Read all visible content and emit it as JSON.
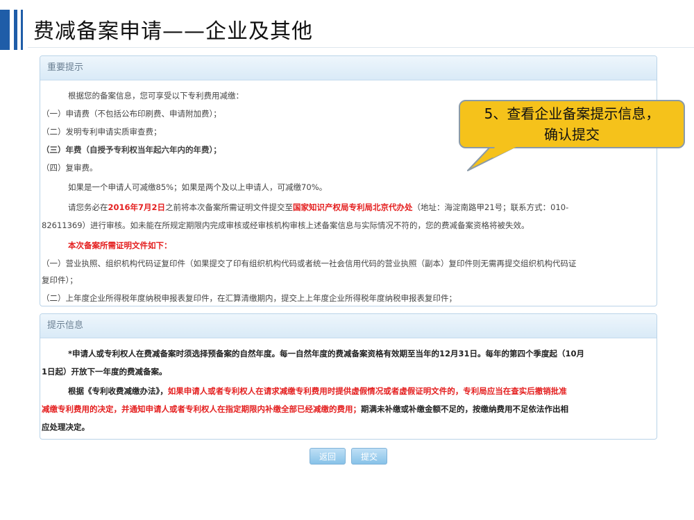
{
  "slide_title": "费减备案申请——企业及其他",
  "important_panel": {
    "header": "重要提示",
    "intro": "根据您的备案信息，您可享受以下专利费用减缴：",
    "fees": [
      "（一）申请费（不包括公布印刷费、申请附加费）；",
      "（二）发明专利申请实质审查费；",
      "（三）年费（自授予专利权当年起六年内的年费）；",
      "（四）复审费。"
    ],
    "reduction_note": "如果是一个申请人可减缴85%；如果是两个及以上申请人，可减缴70%。",
    "deadline": {
      "prefix": "请您务必在",
      "date": "2016年7月2日",
      "middle": "之前将本次备案所需证明文件提交至",
      "office": "国家知识产权局专利局北京代办处",
      "suffix": "（地址：海淀南路甲21号；联系方式：010-",
      "line2": "82611369）进行审核。如未能在所规定期限内完成审核或经审核机构审核上述备案信息与实际情况不符的，您的费减备案资格将被失效。"
    },
    "docs_title": "本次备案所需证明文件如下：",
    "docs": [
      "（一）营业执照、组织机构代码证复印件（如果提交了印有组织机构代码或者统一社会信用代码的营业执照（副本）复印件则无需再提交组织机构代码证",
      "复印件）；",
      "（二）上年度企业所得税年度纳税申报表复印件，在汇算清缴期内，提交上上年度企业所得税年度纳税申报表复印件；"
    ]
  },
  "tips_panel": {
    "header": "提示信息",
    "para1_line1": "*申请人或专利权人在费减备案时须选择预备案的自然年度。每一自然年度的费减备案资格有效期至当年的12月31日。每年的第四个季度起（10月",
    "para1_line2": "1日起）开放下一年度的费减备案。",
    "para2": {
      "prefix": "根据《专利收费减缴办法》，",
      "red1": "如果申请人或者专利权人在请求减缴专利费用时提供虚假情况或者虚假证明文件的，专利局应当在查实后撤销批准",
      "red2": "减缴专利费用的决定，并通知申请人或者专利权人在指定期限内补缴全部已经减缴的费用；",
      "suffix": "期满未补缴或补缴金额不足的，按缴纳费用不足依法作出相",
      "line3": "应处理决定。"
    }
  },
  "buttons": {
    "back": "返回",
    "submit": "提交"
  },
  "callout": {
    "line1": "5、查看企业备案提示信息，",
    "line2": "确认提交"
  },
  "colors": {
    "title_bar": "#1f5da8",
    "highlight_red": "#e41f1f",
    "callout_fill": "#f5c21b",
    "button_blue": "#87c2e8"
  }
}
